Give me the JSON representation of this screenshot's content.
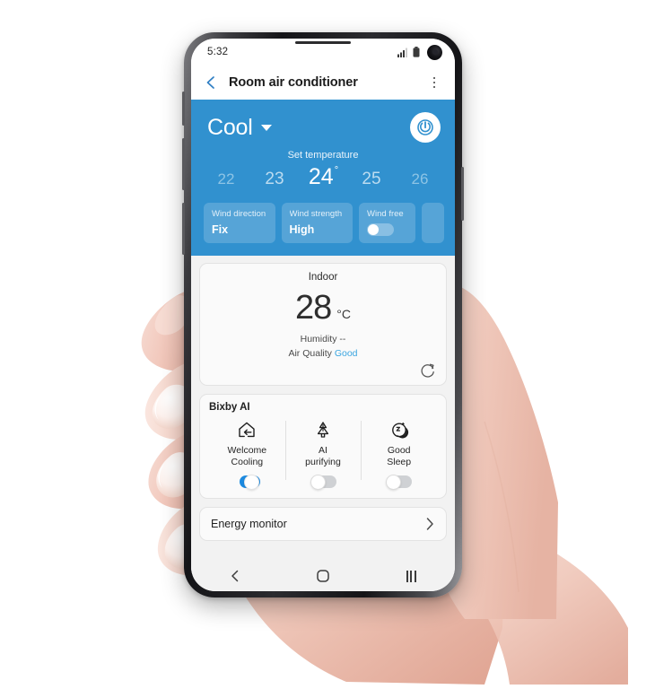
{
  "status_bar": {
    "time": "5:32",
    "signal_icon": "signal-bars-icon",
    "battery_icon": "battery-icon",
    "camera_icon": "front-camera-punch-hole"
  },
  "app_bar": {
    "back_icon": "back-chevron-icon",
    "title": "Room air conditioner",
    "menu_icon": "overflow-menu-icon"
  },
  "hero": {
    "accent_color": "#3191cf",
    "mode": "Cool",
    "mode_caret_icon": "chevron-down-icon",
    "power_icon": "power-icon",
    "set_temperature_label": "Set temperature",
    "temperatures": [
      "22",
      "23",
      "24",
      "25",
      "26"
    ],
    "selected_temperature": "24",
    "degree_symbol": "°",
    "controls": [
      {
        "title": "Wind direction",
        "value": "Fix"
      },
      {
        "title": "Wind strength",
        "value": "High"
      },
      {
        "title": "Wind free",
        "value": "",
        "toggle": "off"
      },
      {
        "title": "",
        "value": ""
      }
    ]
  },
  "indoor": {
    "title": "Indoor",
    "temperature": "28",
    "unit": "°C",
    "humidity_label": "Humidity",
    "humidity_value": "--",
    "air_quality_label": "Air Quality",
    "air_quality_value": "Good",
    "air_quality_color": "#3aa5e0",
    "refresh_icon": "refresh-icon"
  },
  "bixby": {
    "title": "Bixby AI",
    "items": [
      {
        "icon": "house-arrow-in-icon",
        "line1": "Welcome",
        "line2": "Cooling",
        "state": "on"
      },
      {
        "icon": "pine-tree-icon",
        "line1": "AI",
        "line2": "purifying",
        "state": "off"
      },
      {
        "icon": "moon-sleep-icon",
        "line1": "Good",
        "line2": "Sleep",
        "state": "off"
      }
    ],
    "toggle_on_color": "#1c8ae0",
    "toggle_off_color": "#cfd1d4"
  },
  "energy": {
    "label": "Energy monitor",
    "chevron_icon": "chevron-right-icon"
  },
  "nav_bar": {
    "back_icon": "nav-back-icon",
    "home_icon": "nav-home-icon",
    "recents_icon": "nav-recents-icon"
  }
}
